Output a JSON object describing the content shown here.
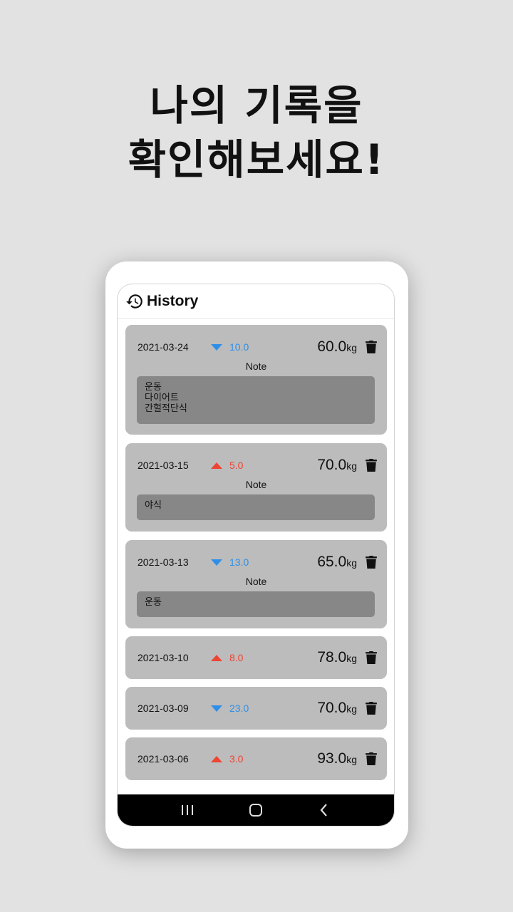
{
  "headline": {
    "line1": "나의 기록을",
    "line2": "확인해보세요!"
  },
  "app": {
    "title": "History",
    "title_icon": "history-icon"
  },
  "colors": {
    "decrease": "#2f8fe8",
    "increase": "#ee4434",
    "card": "#bcbcbc",
    "note_box": "#878787"
  },
  "records": [
    {
      "date": "2021-03-24",
      "trend": "down",
      "delta": "10.0",
      "weight": "60.0",
      "unit": "kg",
      "note_label": "Note",
      "note": "운동\n다이어트\n간헐적단식"
    },
    {
      "date": "2021-03-15",
      "trend": "up",
      "delta": "5.0",
      "weight": "70.0",
      "unit": "kg",
      "note_label": "Note",
      "note": "야식"
    },
    {
      "date": "2021-03-13",
      "trend": "down",
      "delta": "13.0",
      "weight": "65.0",
      "unit": "kg",
      "note_label": "Note",
      "note": "운동"
    },
    {
      "date": "2021-03-10",
      "trend": "up",
      "delta": "8.0",
      "weight": "78.0",
      "unit": "kg"
    },
    {
      "date": "2021-03-09",
      "trend": "down",
      "delta": "23.0",
      "weight": "70.0",
      "unit": "kg"
    },
    {
      "date": "2021-03-06",
      "trend": "up",
      "delta": "3.0",
      "weight": "93.0",
      "unit": "kg"
    }
  ],
  "navbar": {
    "recent_icon": "recent-apps-icon",
    "home_icon": "home-icon",
    "back_icon": "back-icon"
  }
}
